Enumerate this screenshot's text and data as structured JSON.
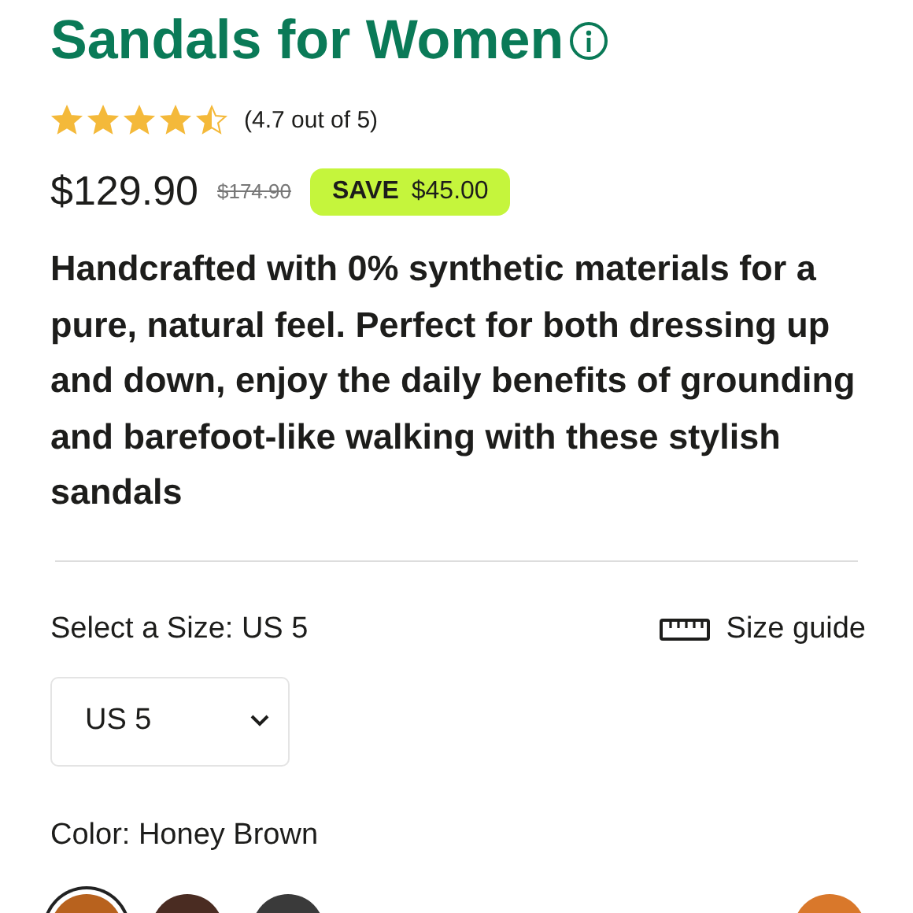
{
  "title": "Sandals for Women",
  "rating": {
    "stars": 4.5,
    "text": "(4.7 out of 5)"
  },
  "price": {
    "current": "$129.90",
    "original": "$174.90",
    "save_label": "SAVE",
    "save_amount": "$45.00"
  },
  "description": "Handcrafted with 0% synthetic materials for a pure, natural feel. Perfect for both dressing up and down, enjoy the daily benefits of grounding and barefoot-like walking with these stylish sandals",
  "size": {
    "label": "Select a Size: US 5",
    "guide": "Size guide",
    "value": "US 5"
  },
  "color": {
    "label": "Color: Honey Brown"
  },
  "swatches": [
    {
      "color": "#b8621e",
      "selected": true
    },
    {
      "color": "#4a2c22",
      "selected": false
    },
    {
      "color": "#3a3a3a",
      "selected": false
    },
    {
      "color": "#d9782b",
      "selected": false
    }
  ]
}
